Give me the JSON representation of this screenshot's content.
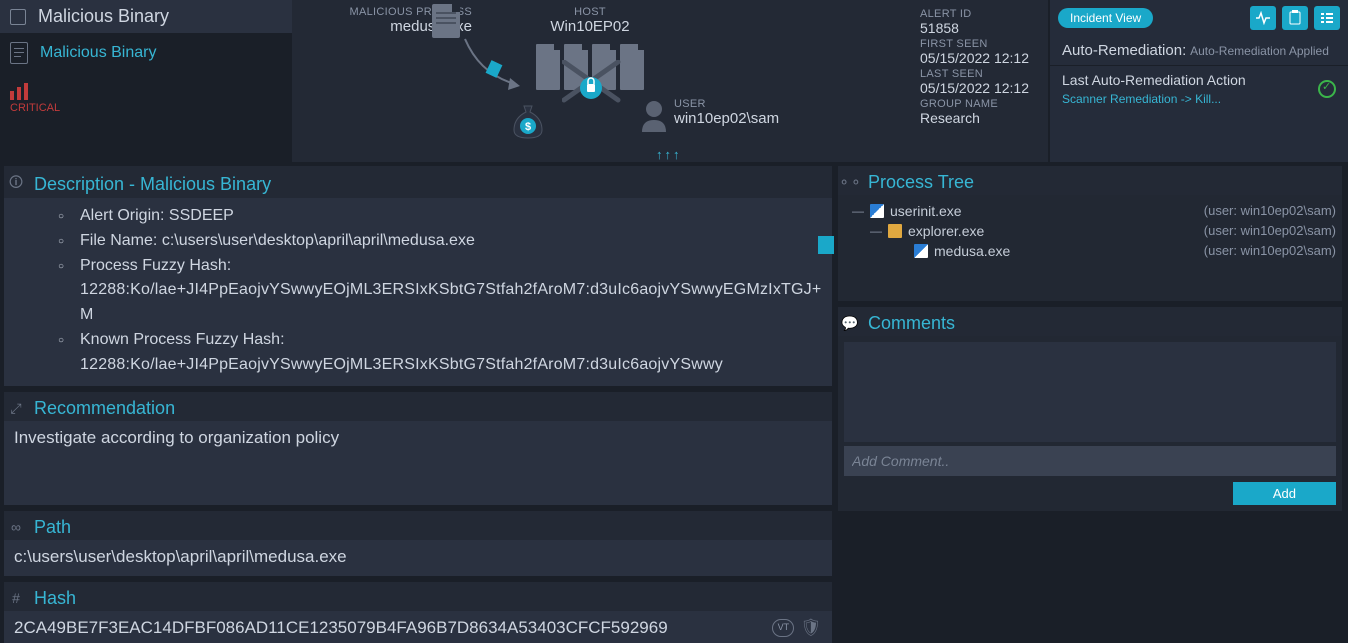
{
  "header": {
    "title": "Malicious Binary",
    "subtitle": "Malicious Binary",
    "critical_label": "CRITICAL"
  },
  "diagram": {
    "malicious_process_label": "MALICIOUS PROCESS",
    "malicious_process_value": "medusa.exe",
    "host_label": "HOST",
    "host_value": "Win10EP02",
    "user_label": "USER",
    "user_value": "win10ep02\\sam"
  },
  "meta": {
    "alert_id_label": "ALERT ID",
    "alert_id_value": "51858",
    "first_seen_label": "FIRST SEEN",
    "first_seen_value": "05/15/2022 12:12",
    "last_seen_label": "LAST SEEN",
    "last_seen_value": "05/15/2022 12:12",
    "group_label": "GROUP NAME",
    "group_value": "Research"
  },
  "right_top": {
    "incident_button": "Incident View",
    "auto_rem_label": "Auto-Remediation:",
    "auto_rem_value": "Auto-Remediation Applied",
    "lar_label": "Last Auto-Remediation Action",
    "lar_link": "Scanner Remediation -> Kill..."
  },
  "description": {
    "title": "Description - Malicious Binary",
    "origin_label": "Alert Origin:",
    "origin_value": "SSDEEP",
    "filename_label": "File Name:",
    "filename_value": "c:\\users\\user\\desktop\\april\\april\\medusa.exe",
    "pfh_label": "Process Fuzzy Hash:",
    "pfh_value": "12288:Ko/lae+JI4PpEaojvYSwwyEOjML3ERSIxKSbtG7Stfah2fAroM7:d3uIc6aojvYSwwyEGMzIxTGJ+M",
    "kpfh_label": "Known Process Fuzzy Hash:",
    "kpfh_value": "12288:Ko/lae+JI4PpEaojvYSwwyEOjML3ERSIxKSbtG7Stfah2fAroM7:d3uIc6aojvYSwwy"
  },
  "recommendation": {
    "title": "Recommendation",
    "text": "Investigate according to organization policy"
  },
  "path": {
    "title": "Path",
    "value": "c:\\users\\user\\desktop\\april\\april\\medusa.exe"
  },
  "hash": {
    "title": "Hash",
    "value": "2CA49BE7F3EAC14DFBF086AD11CE1235079B4FA96B7D8634A53403CFCF592969",
    "vt_badge": "VT"
  },
  "process_tree": {
    "title": "Process Tree",
    "rows": [
      {
        "name": "userinit.exe",
        "user": "(user: win10ep02\\sam)"
      },
      {
        "name": "explorer.exe",
        "user": "(user: win10ep02\\sam)"
      },
      {
        "name": "medusa.exe",
        "user": "(user: win10ep02\\sam)"
      }
    ]
  },
  "comments": {
    "title": "Comments",
    "placeholder": "Add Comment..",
    "add_button": "Add"
  }
}
